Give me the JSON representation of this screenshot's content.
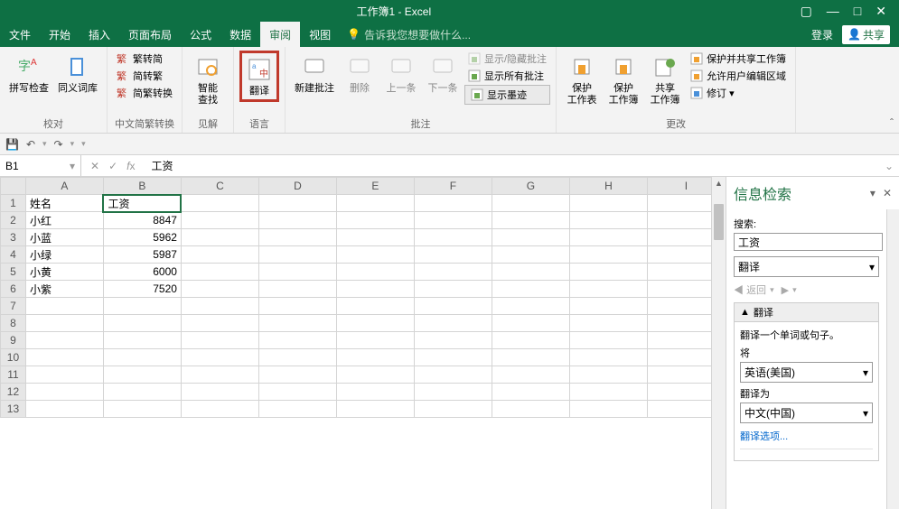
{
  "title": "工作簿1 - Excel",
  "window_controls": {
    "restore": "▢",
    "min": "—",
    "max": "□",
    "close": "✕"
  },
  "menu": {
    "items": [
      "文件",
      "开始",
      "插入",
      "页面布局",
      "公式",
      "数据",
      "审阅",
      "视图"
    ],
    "active_index": 6,
    "tell_me": "告诉我您想要做什么...",
    "login": "登录",
    "share": "共享"
  },
  "ribbon": {
    "groups": [
      {
        "label": "校对",
        "big": [
          {
            "name": "spelling",
            "text": "拼写检查"
          },
          {
            "name": "thesaurus",
            "text": "同义词库"
          }
        ]
      },
      {
        "label": "中文简繁转换",
        "small": [
          {
            "name": "to-simp",
            "text": "繁转简"
          },
          {
            "name": "to-trad",
            "text": "简转繁"
          },
          {
            "name": "conv",
            "text": "简繁转换"
          }
        ]
      },
      {
        "label": "见解",
        "big": [
          {
            "name": "smart-lookup",
            "text": "智能\n查找"
          }
        ]
      },
      {
        "label": "语言",
        "highlighted": true,
        "big": [
          {
            "name": "translate",
            "text": "翻译"
          }
        ]
      },
      {
        "label": "批注",
        "big": [
          {
            "name": "new-comment",
            "text": "新建批注"
          },
          {
            "name": "delete-comment",
            "text": "删除",
            "disabled": true
          },
          {
            "name": "prev-comment",
            "text": "上一条",
            "disabled": true
          },
          {
            "name": "next-comment",
            "text": "下一条",
            "disabled": true
          }
        ],
        "small": [
          {
            "name": "show-hide-comment",
            "text": "显示/隐藏批注",
            "disabled": true
          },
          {
            "name": "show-all-comments",
            "text": "显示所有批注"
          },
          {
            "name": "show-ink",
            "text": "显示墨迹",
            "boxed": true
          }
        ]
      },
      {
        "label": "更改",
        "big": [
          {
            "name": "protect-sheet",
            "text": "保护\n工作表"
          },
          {
            "name": "protect-workbook",
            "text": "保护\n工作簿"
          },
          {
            "name": "share-workbook",
            "text": "共享\n工作簿"
          }
        ],
        "small": [
          {
            "name": "protect-share",
            "text": "保护并共享工作簿"
          },
          {
            "name": "allow-edit-ranges",
            "text": "允许用户编辑区域"
          },
          {
            "name": "track-changes",
            "text": "修订 ▾"
          }
        ]
      }
    ]
  },
  "qat": {
    "save": "💾",
    "undo": "↶",
    "redo": "↷"
  },
  "formula_bar": {
    "name_box": "B1",
    "value": "工资"
  },
  "grid": {
    "columns": [
      "A",
      "B",
      "C",
      "D",
      "E",
      "F",
      "G",
      "H",
      "I"
    ],
    "row_count": 13,
    "selected": {
      "row": 1,
      "col": 1
    },
    "data": [
      [
        "姓名",
        "工资"
      ],
      [
        "小红",
        8847
      ],
      [
        "小蓝",
        5962
      ],
      [
        "小绿",
        5987
      ],
      [
        "小黄",
        6000
      ],
      [
        "小紫",
        7520
      ]
    ]
  },
  "task_pane": {
    "title": "信息检索",
    "search_label": "搜索:",
    "search_value": "工资",
    "service": "翻译",
    "back": "返回",
    "section_title": "翻译",
    "section_desc": "翻译一个单词或句子。",
    "from_label": "将",
    "from_value": "英语(美国)",
    "to_label": "翻译为",
    "to_value": "中文(中国)",
    "options_link": "翻译选项..."
  }
}
